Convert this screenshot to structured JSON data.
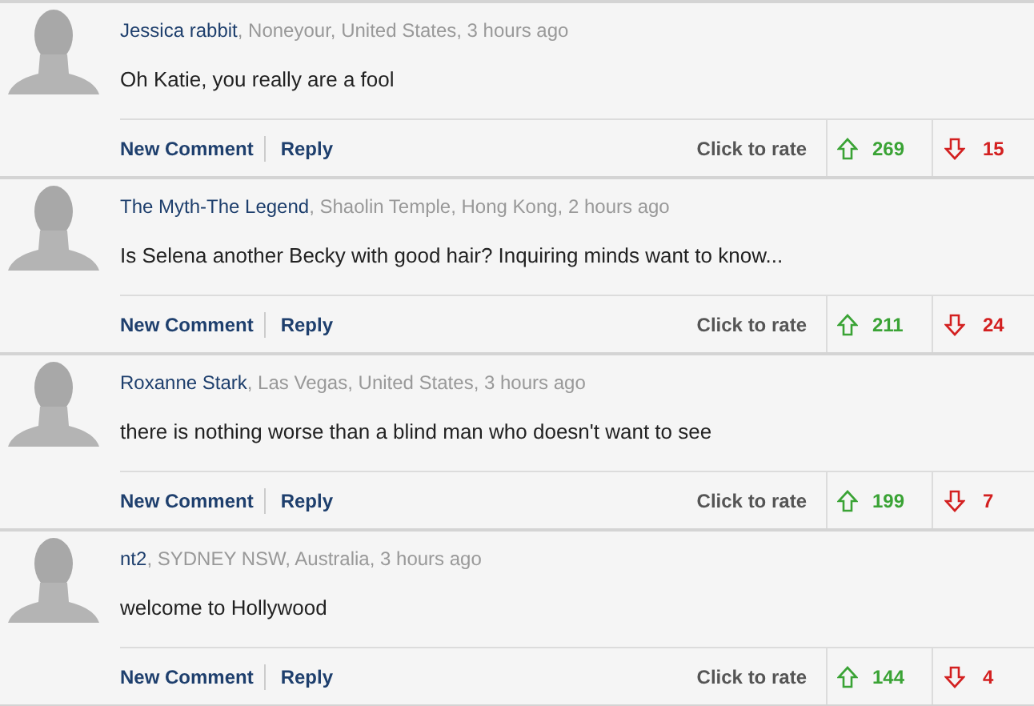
{
  "comments": [
    {
      "author": "Jessica rabbit",
      "meta": ", Noneyour, United States, 3 hours ago",
      "body": "Oh Katie, you really are a fool",
      "new_comment": "New Comment",
      "reply": "Reply",
      "rate_label": "Click to rate",
      "up_votes": "269",
      "down_votes": "15"
    },
    {
      "author": "The Myth-The Legend",
      "meta": ", Shaolin Temple, Hong Kong, 2 hours ago",
      "body": "Is Selena another Becky with good hair? Inquiring minds want to know...",
      "new_comment": "New Comment",
      "reply": "Reply",
      "rate_label": "Click to rate",
      "up_votes": "211",
      "down_votes": "24"
    },
    {
      "author": "Roxanne Stark",
      "meta": ", Las Vegas, United States, 3 hours ago",
      "body": "there is nothing worse than a blind man who doesn't want to see",
      "new_comment": "New Comment",
      "reply": "Reply",
      "rate_label": "Click to rate",
      "up_votes": "199",
      "down_votes": "7"
    },
    {
      "author": "nt2",
      "meta": ", SYDNEY NSW, Australia, 3 hours ago",
      "body": "welcome to Hollywood",
      "new_comment": "New Comment",
      "reply": "Reply",
      "rate_label": "Click to rate",
      "up_votes": "144",
      "down_votes": "4"
    }
  ]
}
